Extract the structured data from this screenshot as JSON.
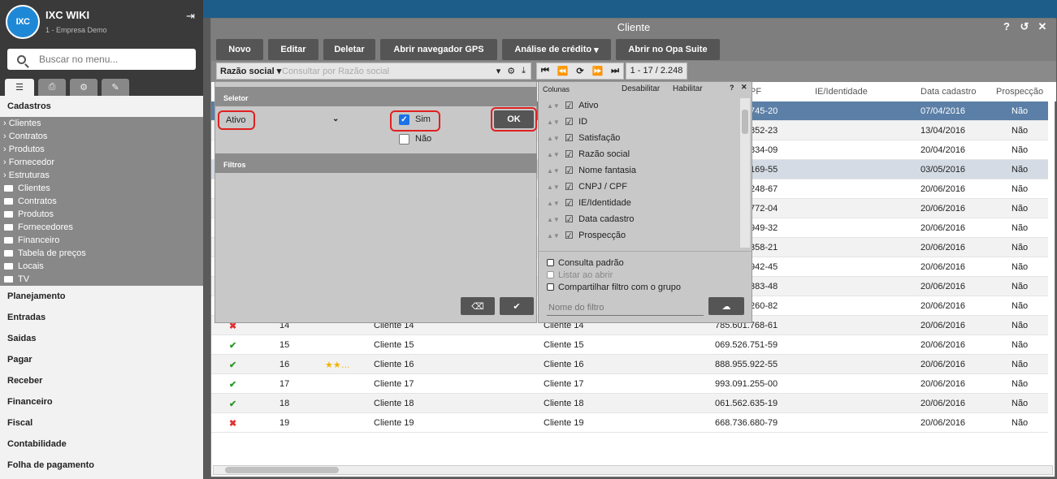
{
  "sidebar": {
    "app_title": "IXC WIKI",
    "company": "1 - Empresa Demo",
    "logo_text": "IXCsoft",
    "search_placeholder": "Buscar no menu...",
    "section": "Cadastros",
    "tree": [
      "Clientes",
      "Contratos",
      "Produtos",
      "Fornecedor",
      "Estruturas"
    ],
    "folders": [
      "Clientes",
      "Contratos",
      "Produtos",
      "Fornecedores",
      "Financeiro",
      "Tabela de preços",
      "Locais",
      "TV"
    ],
    "menu": [
      "Planejamento",
      "Entradas",
      "Saidas",
      "Pagar",
      "Receber",
      "Financeiro",
      "Fiscal",
      "Contabilidade",
      "Folha de pagamento"
    ]
  },
  "window": {
    "title": "Cliente",
    "toolbar": [
      "Novo",
      "Editar",
      "Deletar",
      "Abrir navegador GPS",
      "Análise de crédito",
      "Abrir no Opa Suite"
    ],
    "search_field": "Razão social",
    "search_placeholder": "Consultar por Razão social",
    "count": "1 - 17 / 2.248",
    "columns": [
      "PF",
      "IE/Identidade",
      "Data cadastro",
      "Prospecção"
    ]
  },
  "rows_top": [
    {
      "cpf": "745-20",
      "date": "07/04/2016",
      "prosp": "Não"
    },
    {
      "cpf": "852-23",
      "date": "13/04/2016",
      "prosp": "Não"
    },
    {
      "cpf": "834-09",
      "date": "20/04/2016",
      "prosp": "Não"
    },
    {
      "cpf": "169-55",
      "date": "03/05/2016",
      "prosp": "Não"
    },
    {
      "cpf": "248-67",
      "date": "20/06/2016",
      "prosp": "Não"
    },
    {
      "cpf": "772-04",
      "date": "20/06/2016",
      "prosp": "Não"
    },
    {
      "cpf": "949-32",
      "date": "20/06/2016",
      "prosp": "Não"
    },
    {
      "cpf": "358-21",
      "date": "20/06/2016",
      "prosp": "Não"
    },
    {
      "cpf": "942-45",
      "date": "20/06/2016",
      "prosp": "Não"
    },
    {
      "cpf": "383-48",
      "date": "20/06/2016",
      "prosp": "Não"
    },
    {
      "cpf": "260-82",
      "date": "20/06/2016",
      "prosp": "Não"
    }
  ],
  "rows_bottom": [
    {
      "status": "no",
      "id": "14",
      "stars": "",
      "razao": "Cliente 14",
      "fantasia": "Cliente 14",
      "cpf": "785.601.768-61",
      "date": "20/06/2016",
      "prosp": "Não"
    },
    {
      "status": "ok",
      "id": "15",
      "stars": "",
      "razao": "Cliente 15",
      "fantasia": "Cliente 15",
      "cpf": "069.526.751-59",
      "date": "20/06/2016",
      "prosp": "Não"
    },
    {
      "status": "ok",
      "id": "16",
      "stars": "★★…",
      "razao": "Cliente 16",
      "fantasia": "Cliente 16",
      "cpf": "888.955.922-55",
      "date": "20/06/2016",
      "prosp": "Não"
    },
    {
      "status": "ok",
      "id": "17",
      "stars": "",
      "razao": "Cliente 17",
      "fantasia": "Cliente 17",
      "cpf": "993.091.255-00",
      "date": "20/06/2016",
      "prosp": "Não"
    },
    {
      "status": "ok",
      "id": "18",
      "stars": "",
      "razao": "Cliente 18",
      "fantasia": "Cliente 18",
      "cpf": "061.562.635-19",
      "date": "20/06/2016",
      "prosp": "Não"
    },
    {
      "status": "no",
      "id": "19",
      "stars": "",
      "razao": "Cliente 19",
      "fantasia": "Cliente 19",
      "cpf": "668.736.680-79",
      "date": "20/06/2016",
      "prosp": "Não"
    }
  ],
  "filter": {
    "selector_title": "Seletor",
    "selector_value": "Ativo",
    "sim": "Sim",
    "nao": "Não",
    "ok": "OK",
    "filters_title": "Filtros"
  },
  "columns_panel": {
    "title": "Colunas",
    "disable": "Desabilitar",
    "enable": "Habilitar",
    "items": [
      "Ativo",
      "ID",
      "Satisfação",
      "Razão social",
      "Nome fantasia",
      "CNPJ / CPF",
      "IE/Identidade",
      "Data cadastro",
      "Prospecção"
    ],
    "consulta_padrao": "Consulta padrão",
    "listar_ao_abrir": "Listar ao abrir",
    "compartilhar": "Compartilhar filtro com o grupo",
    "nome_filtro_placeholder": "Nome do filtro"
  },
  "colors": {
    "accent": "#1d5d8a",
    "selected_row": "#5b7fa6",
    "highlight": "#e02020"
  }
}
